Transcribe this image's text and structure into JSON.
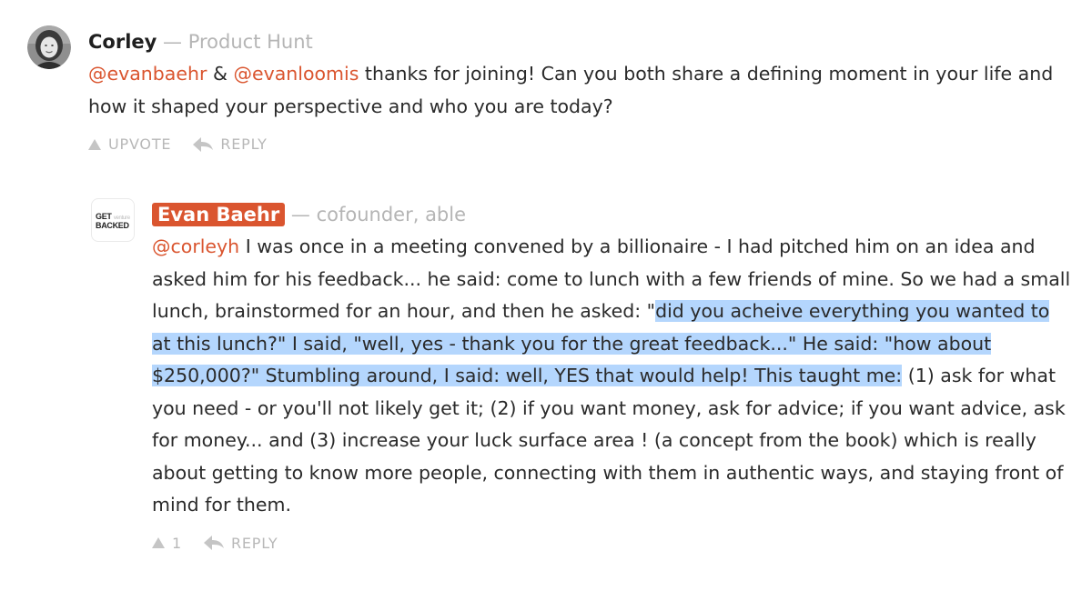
{
  "comments": [
    {
      "author": "Corley",
      "separator": "—",
      "headline": "Product Hunt",
      "avatar_icon": "user-photo-avatar",
      "text_segments": {
        "m1": "@evanbaehr",
        "t1": " & ",
        "m2": "@evanloomis",
        "t2": " thanks for joining! Can you both share a defining moment in your life and how it shaped your perspective and who you are today?"
      },
      "upvote_label": "UPVOTE",
      "reply_label": "REPLY"
    },
    {
      "author": "Evan Baehr",
      "separator": "—",
      "headline": "cofounder, able",
      "avatar_icon": "get-backed-book-avatar",
      "avatar_logo": {
        "line1": "GET",
        "line1_small": "venture",
        "line2": "BACKED"
      },
      "text_segments": {
        "m1": "@corleyh",
        "t1": " I was once in a meeting convened by a billionaire - I had pitched him on an idea and asked him for his feedback... he said: come to lunch with a few friends of mine. So we had a small lunch, brainstormed for an hour, and then he asked: \"",
        "h1": "did you acheive everything you wanted to at this lunch?\"",
        "h2": " I said, \"well, yes - thank you for the great feedback...\" He said: \"how about $250,000?\" Stumbling around, I said: well, YES that would help! This taught me:",
        "t2": " (1) ask for what you need - or you'll not likely get it; (2) if you want money, ask for advice; if you want advice, ask for money... and (3) increase your luck surface area ! (a concept from the book) which is really about getting to know more people, connecting with them in authentic ways, and staying front of mind for them."
      },
      "upvote_count": "1",
      "reply_label": "REPLY"
    }
  ],
  "colors": {
    "accent": "#da552f",
    "selection": "#b4d6fd",
    "muted": "#b5b5b5"
  }
}
